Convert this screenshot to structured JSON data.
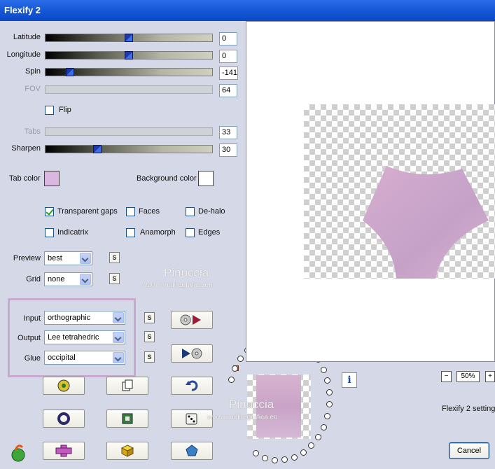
{
  "window": {
    "title": "Flexify 2"
  },
  "sliders": [
    {
      "label": "Latitude",
      "value": "0",
      "level": 0.5,
      "enabled": true
    },
    {
      "label": "Longitude",
      "value": "0",
      "level": 0.5,
      "enabled": true
    },
    {
      "label": "Spin",
      "value": "-141",
      "level": 0.13,
      "enabled": true
    },
    {
      "label": "FOV",
      "value": "64",
      "level": null,
      "enabled": false
    },
    {
      "label": "Tabs",
      "value": "33",
      "level": null,
      "enabled": false
    },
    {
      "label": "Sharpen",
      "value": "30",
      "level": 0.3,
      "enabled": true
    }
  ],
  "flip": {
    "label": "Flip",
    "checked": false
  },
  "colors": {
    "tab_label": "Tab color",
    "tab_value": "#d9b7e0",
    "bg_label": "Background color",
    "bg_value": "#ffffff"
  },
  "checkboxes": [
    {
      "label": "Transparent gaps",
      "checked": true
    },
    {
      "label": "Faces",
      "checked": false
    },
    {
      "label": "De-halo",
      "checked": false
    },
    {
      "label": "Indicatrix",
      "checked": false
    },
    {
      "label": "Anamorph",
      "checked": false
    },
    {
      "label": "Edges",
      "checked": false
    }
  ],
  "preview_select": {
    "label": "Preview",
    "value": "best"
  },
  "grid_select": {
    "label": "Grid",
    "value": "none"
  },
  "input_select": {
    "label": "Input",
    "value": "orthographic"
  },
  "output_select": {
    "label": "Output",
    "value": "Lee tetrahedric"
  },
  "glue_select": {
    "label": "Glue",
    "value": "occipital"
  },
  "s_label": "S",
  "watermark": {
    "name": "Pinuccia",
    "site": "www.maidiregrafica.eu"
  },
  "zoom": {
    "value": "50%",
    "minus": "−",
    "plus": "+"
  },
  "settings_label": "Flexify 2 setting",
  "info_label": "i",
  "cancel_label": "Cancel",
  "accent": "#c9a8cf"
}
